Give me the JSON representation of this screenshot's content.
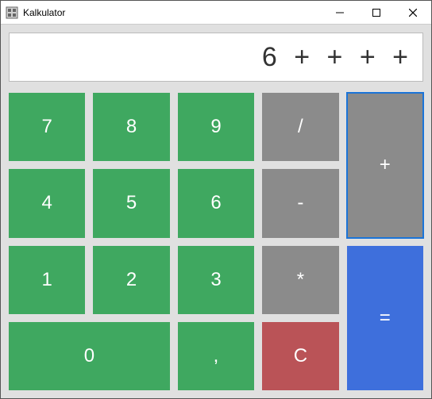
{
  "window": {
    "title": "Kalkulator"
  },
  "display": {
    "value": "6 + + + +"
  },
  "buttons": {
    "n7": "7",
    "n8": "8",
    "n9": "9",
    "divide": "/",
    "plus": "+",
    "n4": "4",
    "n5": "5",
    "n6": "6",
    "minus": "-",
    "n1": "1",
    "n2": "2",
    "n3": "3",
    "multiply": "*",
    "equals": "=",
    "n0": "0",
    "comma": ",",
    "clear": "C"
  },
  "colors": {
    "digit": "#3fa860",
    "operator": "#8b8b8b",
    "clear": "#ba5357",
    "equals": "#3e6fdc"
  }
}
